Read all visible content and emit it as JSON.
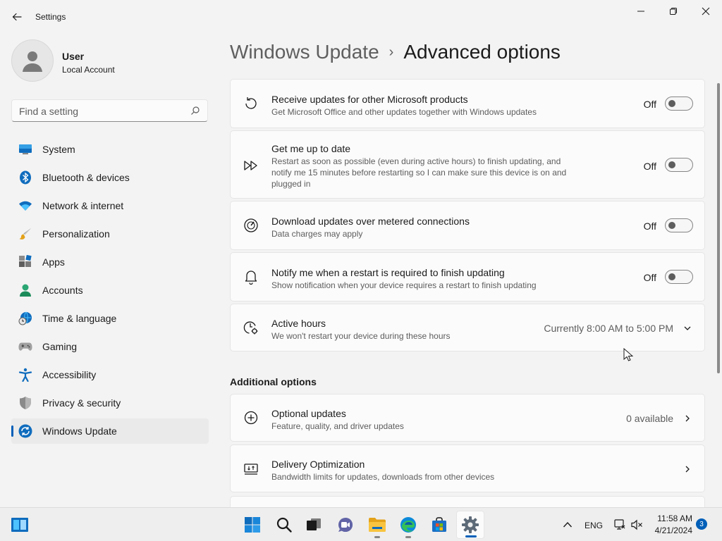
{
  "window": {
    "app_title": "Settings"
  },
  "profile": {
    "name": "User",
    "account_type": "Local Account"
  },
  "search": {
    "placeholder": "Find a setting"
  },
  "nav": [
    {
      "label": "System",
      "icon": "monitor-icon"
    },
    {
      "label": "Bluetooth & devices",
      "icon": "bluetooth-icon"
    },
    {
      "label": "Network & internet",
      "icon": "wifi-icon"
    },
    {
      "label": "Personalization",
      "icon": "brush-icon"
    },
    {
      "label": "Apps",
      "icon": "apps-icon"
    },
    {
      "label": "Accounts",
      "icon": "person-icon"
    },
    {
      "label": "Time & language",
      "icon": "globe-clock-icon"
    },
    {
      "label": "Gaming",
      "icon": "gamepad-icon"
    },
    {
      "label": "Accessibility",
      "icon": "accessibility-icon"
    },
    {
      "label": "Privacy & security",
      "icon": "shield-icon"
    },
    {
      "label": "Windows Update",
      "icon": "update-icon",
      "selected": true
    }
  ],
  "breadcrumb": {
    "parent": "Windows Update",
    "separator": "›",
    "current": "Advanced options"
  },
  "settings": [
    {
      "title": "Receive updates for other Microsoft products",
      "description": "Get Microsoft Office and other updates together with Windows updates",
      "state": "Off",
      "icon": "refresh-icon"
    },
    {
      "title": "Get me up to date",
      "description": "Restart as soon as possible (even during active hours) to finish updating, and notify me 15 minutes before restarting so I can make sure this device is on and plugged in",
      "state": "Off",
      "icon": "fast-forward-icon"
    },
    {
      "title": "Download updates over metered connections",
      "description": "Data charges may apply",
      "state": "Off",
      "icon": "gauge-icon"
    },
    {
      "title": "Notify me when a restart is required to finish updating",
      "description": "Show notification when your device requires a restart to finish updating",
      "state": "Off",
      "icon": "bell-icon"
    }
  ],
  "active_hours": {
    "title": "Active hours",
    "description": "We won't restart your device during these hours",
    "value": "Currently 8:00 AM to 5:00 PM",
    "icon": "clock-gear-icon"
  },
  "additional": {
    "section_title": "Additional options",
    "items": [
      {
        "title": "Optional updates",
        "description": "Feature, quality, and driver updates",
        "value": "0 available",
        "icon": "plus-circle-icon"
      },
      {
        "title": "Delivery Optimization",
        "description": "Bandwidth limits for updates, downloads from other devices",
        "value": "",
        "icon": "delivery-icon"
      }
    ]
  },
  "taskbar": {
    "language": "ENG",
    "time": "11:58 AM",
    "date": "4/21/2024",
    "notification_count": "3"
  },
  "colors": {
    "accent": "#005fb8",
    "background": "#f3f3f3",
    "card": "#fbfbfb"
  }
}
